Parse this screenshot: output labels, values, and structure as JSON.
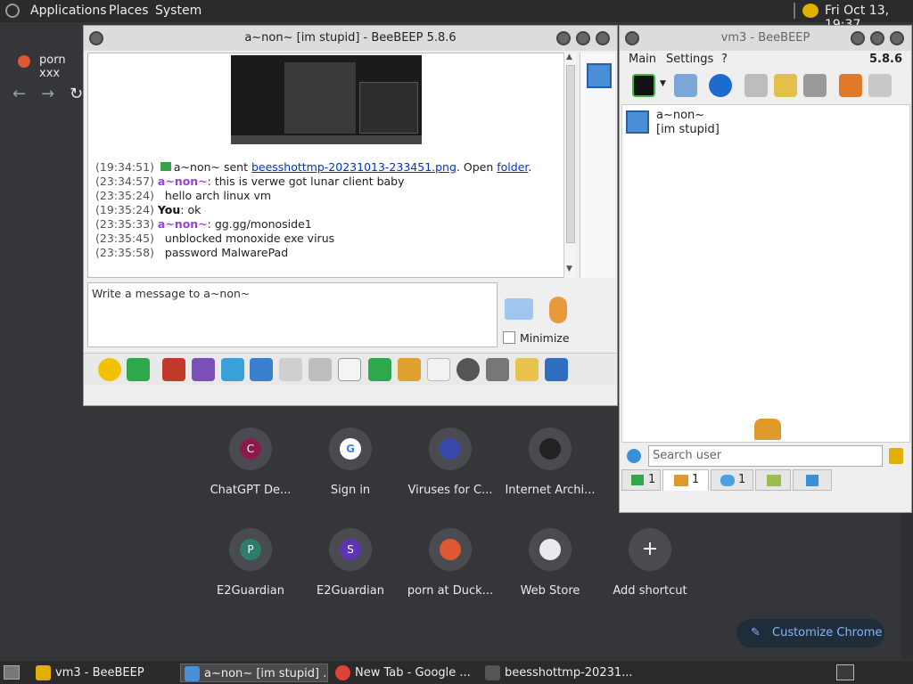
{
  "top_panel": {
    "applications": "Applications",
    "places": "Places",
    "system": "System",
    "clock": "Fri Oct 13, 19:37"
  },
  "chrome": {
    "tab_title": "porn xxx",
    "shortcuts": [
      {
        "label": "ChatGPT De...",
        "initial": "C",
        "color": "#8b1a4a"
      },
      {
        "label": "Sign in",
        "initial": "G",
        "color": "#ffffff"
      },
      {
        "label": "Viruses for C...",
        "initial": "",
        "color": "#3949ab"
      },
      {
        "label": "Internet Archi...",
        "initial": "",
        "color": "#222222"
      },
      {
        "label": "E2Guardian",
        "initial": "P",
        "color": "#2e7d6b"
      },
      {
        "label": "E2Guardian",
        "initial": "S",
        "color": "#5e35b1"
      },
      {
        "label": "porn at Duck...",
        "initial": "",
        "color": "#de5833"
      },
      {
        "label": "Web Store",
        "initial": "",
        "color": "#e8eaed"
      },
      {
        "label": "Add shortcut",
        "initial": "+",
        "color": "#4a4b50"
      }
    ],
    "customize_label": "Customize Chrome"
  },
  "chat_window": {
    "title": "a~non~ [im stupid] - BeeBEEP 5.8.6",
    "messages": [
      {
        "time": "(19:34:51)",
        "nick": "",
        "text": "a~non~ sent ",
        "link": "beesshottmp-20231013-233451.png",
        "after": ". Open ",
        "link2": "folder",
        "end": "."
      },
      {
        "time": "(23:34:57)",
        "nick": "a~non~",
        "text": ": this is verwe got lunar client baby"
      },
      {
        "time": "(23:35:24)",
        "nick": "",
        "text": "hello arch linux vm"
      },
      {
        "time": "(19:35:24)",
        "nick": "You",
        "text": ": ok"
      },
      {
        "time": "(23:35:33)",
        "nick": "a~non~",
        "text": ": gg.gg/monoside1"
      },
      {
        "time": "(23:35:45)",
        "nick": "",
        "text": "unblocked monoxide exe virus"
      },
      {
        "time": "(23:35:58)",
        "nick": "",
        "text": "password MalwarePad"
      }
    ],
    "input_placeholder": "Write a message to a~non~",
    "minimize_label": "Minimize"
  },
  "main_window": {
    "title": "vm3 - BeeBEEP",
    "menu": [
      "Main",
      "Settings",
      "?"
    ],
    "version": "5.8.6",
    "user_name": "a~non~",
    "user_status": "[im stupid]",
    "search_placeholder": "Search user",
    "tabs": [
      {
        "count": "1"
      },
      {
        "count": "1"
      },
      {
        "count": "1"
      },
      {
        "count": ""
      },
      {
        "count": ""
      }
    ]
  },
  "taskbar": {
    "items": [
      {
        "label": "vm3 - BeeBEEP"
      },
      {
        "label": "a~non~ [im stupid] ..."
      },
      {
        "label": "New Tab - Google ..."
      },
      {
        "label": "beesshottmp-20231..."
      }
    ]
  }
}
